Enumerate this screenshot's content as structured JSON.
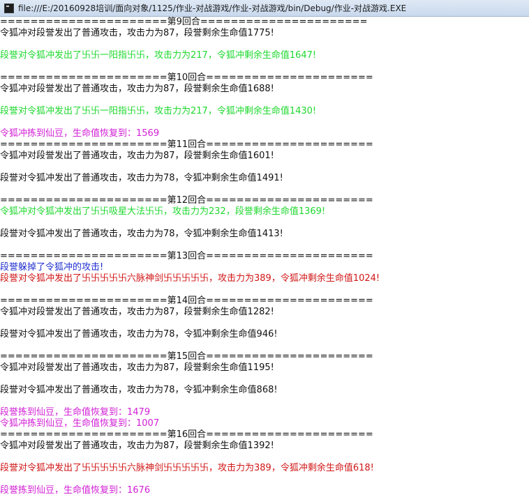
{
  "window": {
    "title": "file:///E:/20160928培训/面向对象/1125/作业-对战游戏/作业-对战游戏/bin/Debug/作业-对战游戏.EXE"
  },
  "colors": {
    "default": "#111111",
    "green": "#1ed82e",
    "magenta": "#d21fd6",
    "blue": "#1f2fd0",
    "red": "#d11616"
  },
  "console": {
    "lines": [
      {
        "type": "sep",
        "text": "======================第9回合======================"
      },
      {
        "type": "text",
        "color": "default",
        "text": "令狐冲对段誉发出了普通攻击，攻击力为87，段誉剩余生命值1775!"
      },
      {
        "type": "blank",
        "text": ""
      },
      {
        "type": "text",
        "color": "green",
        "text": "段誉对令狐冲发出了卐卐一阳指卐卐，攻击力为217，令狐冲剩余生命值1647!"
      },
      {
        "type": "blank",
        "text": ""
      },
      {
        "type": "sep",
        "text": "======================第10回合======================"
      },
      {
        "type": "text",
        "color": "default",
        "text": "令狐冲对段誉发出了普通攻击，攻击力为87，段誉剩余生命值1688!"
      },
      {
        "type": "blank",
        "text": ""
      },
      {
        "type": "text",
        "color": "green",
        "text": "段誉对令狐冲发出了卐卐一阳指卐卐，攻击力为217，令狐冲剩余生命值1430!"
      },
      {
        "type": "blank",
        "text": ""
      },
      {
        "type": "text",
        "color": "magenta",
        "text": "令狐冲拣到仙豆，生命值恢复到：1569"
      },
      {
        "type": "sep",
        "text": "======================第11回合======================"
      },
      {
        "type": "text",
        "color": "default",
        "text": "令狐冲对段誉发出了普通攻击，攻击力为87，段誉剩余生命值1601!"
      },
      {
        "type": "blank",
        "text": ""
      },
      {
        "type": "text",
        "color": "default",
        "text": "段誉对令狐冲发出了普通攻击，攻击力为78，令狐冲剩余生命值1491!"
      },
      {
        "type": "blank",
        "text": ""
      },
      {
        "type": "sep",
        "text": "======================第12回合======================"
      },
      {
        "type": "text",
        "color": "green",
        "text": "令狐冲对令狐冲发出了卐卐吸星大法卐卐，攻击力为232，段誉剩余生命值1369!"
      },
      {
        "type": "blank",
        "text": ""
      },
      {
        "type": "text",
        "color": "default",
        "text": "段誉对令狐冲发出了普通攻击，攻击力为78，令狐冲剩余生命值1413!"
      },
      {
        "type": "blank",
        "text": ""
      },
      {
        "type": "sep",
        "text": "======================第13回合======================"
      },
      {
        "type": "text",
        "color": "blue",
        "text": "段誉躲掉了令狐冲的攻击!"
      },
      {
        "type": "text",
        "color": "red",
        "text": "段誉对令狐冲发出了卐卐卐卐卐六脉神剑卐卐卐卐卐，攻击力为389，令狐冲剩余生命值1024!"
      },
      {
        "type": "blank",
        "text": ""
      },
      {
        "type": "sep",
        "text": "======================第14回合======================"
      },
      {
        "type": "text",
        "color": "default",
        "text": "令狐冲对段誉发出了普通攻击，攻击力为87，段誉剩余生命值1282!"
      },
      {
        "type": "blank",
        "text": ""
      },
      {
        "type": "text",
        "color": "default",
        "text": "段誉对令狐冲发出了普通攻击，攻击力为78，令狐冲剩余生命值946!"
      },
      {
        "type": "blank",
        "text": ""
      },
      {
        "type": "sep",
        "text": "======================第15回合======================"
      },
      {
        "type": "text",
        "color": "default",
        "text": "令狐冲对段誉发出了普通攻击，攻击力为87，段誉剩余生命值1195!"
      },
      {
        "type": "blank",
        "text": ""
      },
      {
        "type": "text",
        "color": "default",
        "text": "段誉对令狐冲发出了普通攻击，攻击力为78，令狐冲剩余生命值868!"
      },
      {
        "type": "blank",
        "text": ""
      },
      {
        "type": "text",
        "color": "magenta",
        "text": "段誉拣到仙豆，生命值恢复到：1479"
      },
      {
        "type": "text",
        "color": "magenta",
        "text": "令狐冲拣到仙豆，生命值恢复到：1007"
      },
      {
        "type": "sep",
        "text": "======================第16回合======================"
      },
      {
        "type": "text",
        "color": "default",
        "text": "令狐冲对段誉发出了普通攻击，攻击力为87，段誉剩余生命值1392!"
      },
      {
        "type": "blank",
        "text": ""
      },
      {
        "type": "text",
        "color": "red",
        "text": "段誉对令狐冲发出了卐卐卐卐卐六脉神剑卐卐卐卐卐，攻击力为389，令狐冲剩余生命值618!"
      },
      {
        "type": "blank",
        "text": ""
      },
      {
        "type": "text",
        "color": "magenta",
        "text": "段誉拣到仙豆，生命值恢复到：1676"
      }
    ]
  }
}
